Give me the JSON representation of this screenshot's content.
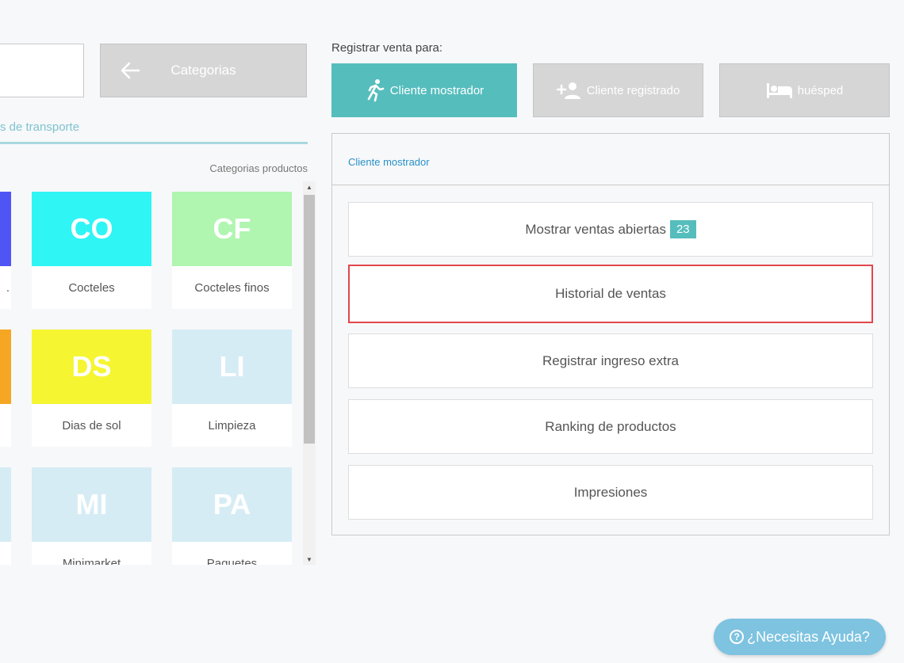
{
  "left": {
    "categories_label": "Categorias",
    "tab_label": "s de transporte",
    "grid_header": "Categorias productos",
    "tiles": [
      {
        "abbr": "",
        "name": ".",
        "color": "#4f55f5"
      },
      {
        "abbr": "CO",
        "name": "Cocteles",
        "color": "#2ff5f5"
      },
      {
        "abbr": "CF",
        "name": "Cocteles finos",
        "color": "#b0f5b0"
      },
      {
        "abbr": "",
        "name": "",
        "color": "#f5a623"
      },
      {
        "abbr": "DS",
        "name": "Dias de sol",
        "color": "#f5f532"
      },
      {
        "abbr": "LI",
        "name": "Limpieza",
        "color": "#d6ecf5"
      },
      {
        "abbr": "",
        "name": "",
        "color": "#d6ecf5"
      },
      {
        "abbr": "MI",
        "name": "Minimarket",
        "color": "#d6ecf5"
      },
      {
        "abbr": "PA",
        "name": "Paquetes",
        "color": "#d6ecf5"
      }
    ]
  },
  "right": {
    "register_label": "Registrar venta para:",
    "customer_buttons": {
      "mostrador": "Cliente mostrador",
      "registrado": "Cliente registrado",
      "huesped": "huésped"
    },
    "panel_title": "Cliente mostrador",
    "actions": {
      "open_sales": "Mostrar ventas abiertas",
      "open_sales_count": "23",
      "history": "Historial de ventas",
      "extra_income": "Registrar ingreso extra",
      "ranking": "Ranking de productos",
      "prints": "Impresiones"
    }
  },
  "help": {
    "label": "¿Necesitas Ayuda?"
  },
  "colors": {
    "accent": "#56bdbd",
    "highlight": "#e0474c",
    "link": "#2a90c7"
  }
}
